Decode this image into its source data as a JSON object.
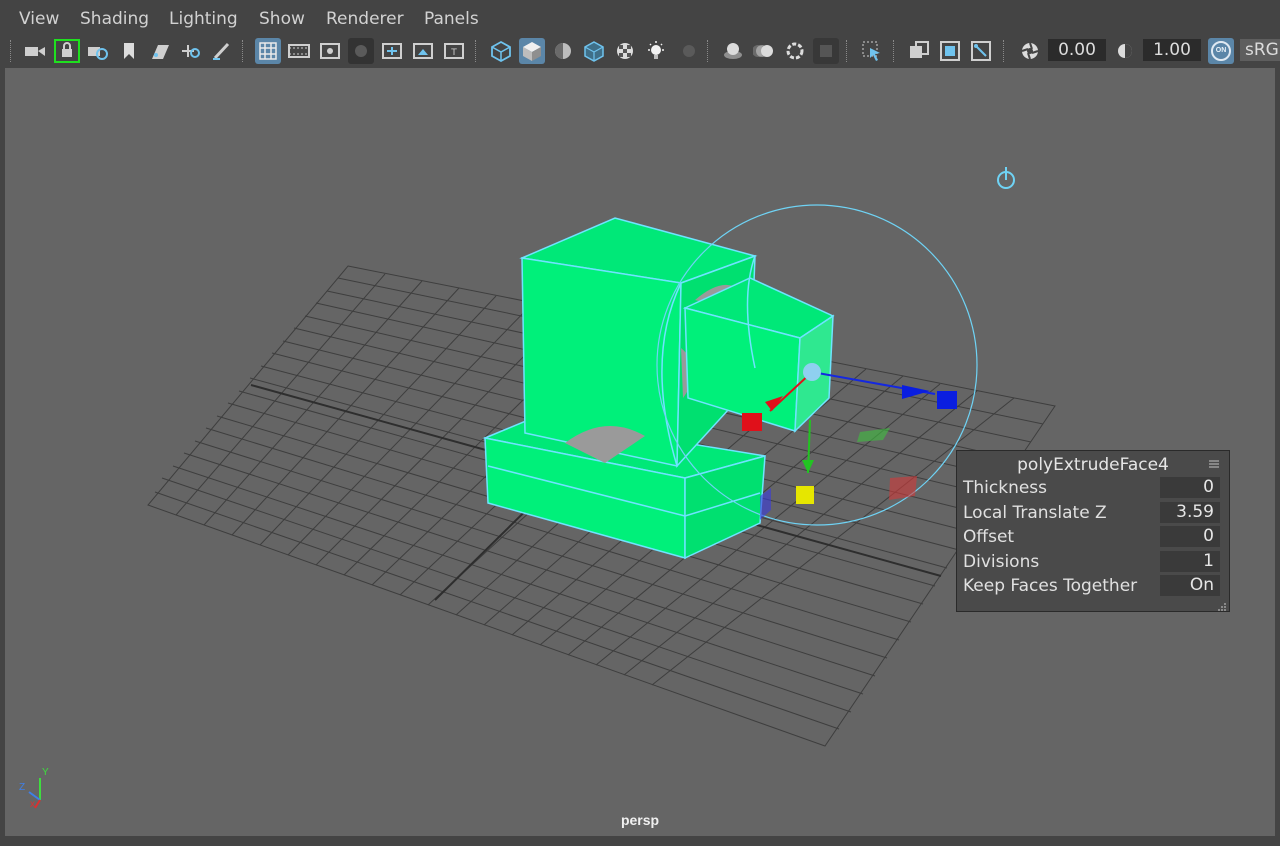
{
  "menubar": {
    "items": [
      "View",
      "Shading",
      "Lighting",
      "Show",
      "Renderer",
      "Panels"
    ]
  },
  "toolbar": {
    "icons": [
      "camera-icon",
      "lock-camera-icon",
      "camera-attributes-icon",
      "bookmark-icon",
      "image-plane-icon",
      "2d-pan-zoom-icon",
      "grease-pencil-icon",
      "grid-icon",
      "film-gate-icon",
      "resolution-gate-icon",
      "gate-mask-icon",
      "field-chart-icon",
      "safe-action-icon",
      "safe-title-icon",
      "wireframe-icon",
      "smooth-shade-icon",
      "default-material-icon",
      "wireframe-on-shaded-icon",
      "textured-icon",
      "use-all-lights-icon",
      "shadows-icon",
      "screen-space-ao-icon",
      "motion-blur-icon",
      "multisample-aa-icon",
      "depth-of-field-icon",
      "isolate-select-icon",
      "xray-icon",
      "xray-active-components-icon",
      "xray-joints-icon",
      "exposure-icon",
      "gamma-icon",
      "color-management-icon"
    ],
    "exposure_value": "0.00",
    "gamma_value": "1.00",
    "color_space": "sRG",
    "cm_badge": "ON"
  },
  "viewport": {
    "camera_label": "persp",
    "axis_labels": {
      "x": "x",
      "y": "Y",
      "z": "Z"
    }
  },
  "panel": {
    "title": "polyExtrudeFace4",
    "rows": [
      {
        "label": "Thickness",
        "value": "0"
      },
      {
        "label": "Local Translate Z",
        "value": "3.59"
      },
      {
        "label": "Offset",
        "value": "0"
      },
      {
        "label": "Divisions",
        "value": "1"
      },
      {
        "label": "Keep Faces Together",
        "value": "On"
      }
    ]
  },
  "colors": {
    "mesh": "#00f07a",
    "selection": "#6fe3ff",
    "manip_x": "#e0101a",
    "manip_y": "#e6e600",
    "manip_z": "#0a1ee0",
    "panel_bg": "#4a4a4a",
    "active_button": "#5b86a8"
  }
}
